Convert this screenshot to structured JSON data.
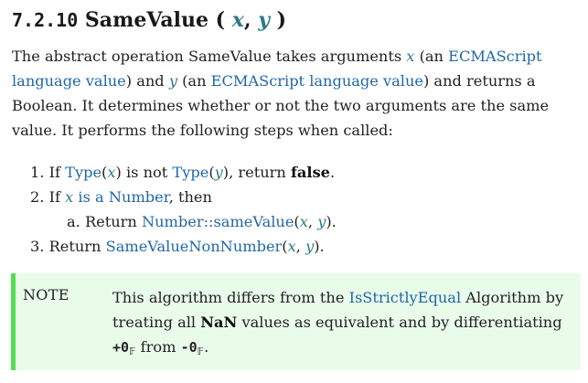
{
  "heading": {
    "number": "7.2.10",
    "title": "SameValue",
    "open": " ( ",
    "arg1": "x",
    "comma": ", ",
    "arg2": "y",
    "close": " )"
  },
  "intro": {
    "t1": "The abstract operation SameValue takes arguments ",
    "x": "x",
    "t2": " (an ",
    "link1": "ECMAScript language value",
    "t3": ") and ",
    "y": "y",
    "t4": " (an ",
    "link2": "ECMAScript language value",
    "t5": ") and returns a Boolean. It determines whether or not the two arguments are the same value. It performs the following steps when called:"
  },
  "steps": [
    {
      "num": "1.",
      "parts": {
        "a": "If ",
        "type1": "Type",
        "b": "(",
        "x": "x",
        "c": ") is not ",
        "type2": "Type",
        "d": "(",
        "y": "y",
        "e": "), return ",
        "strong": "false",
        "f": "."
      }
    },
    {
      "num": "2.",
      "parts": {
        "a": "If ",
        "x": "x",
        "link": " is a Number",
        "b": ", then"
      }
    },
    {
      "num": "a.",
      "parts": {
        "a": "Return ",
        "link": "Number::sameValue",
        "b": "(",
        "x": "x",
        "c": ", ",
        "y": "y",
        "d": ")."
      }
    },
    {
      "num": "3.",
      "parts": {
        "a": "Return ",
        "link": "SameValueNonNumber",
        "b": "(",
        "x": "x",
        "c": ", ",
        "y": "y",
        "d": ")."
      }
    }
  ],
  "note": {
    "label": "NOTE",
    "t1": "This algorithm differs from the ",
    "link": "IsStrictlyEqual",
    "t2": " Algorithm by treating all ",
    "nan": "NaN",
    "t3": " values as equivalent and by differentiating ",
    "pz": "+0",
    "sub1": "𝔽",
    "t4": " from ",
    "nz": "-0",
    "sub2": "𝔽",
    "t5": "."
  },
  "colors": {
    "link": "#2067a8",
    "var": "#2f7a8a",
    "note_bg": "#e9fbe9",
    "note_border": "#52e052"
  }
}
